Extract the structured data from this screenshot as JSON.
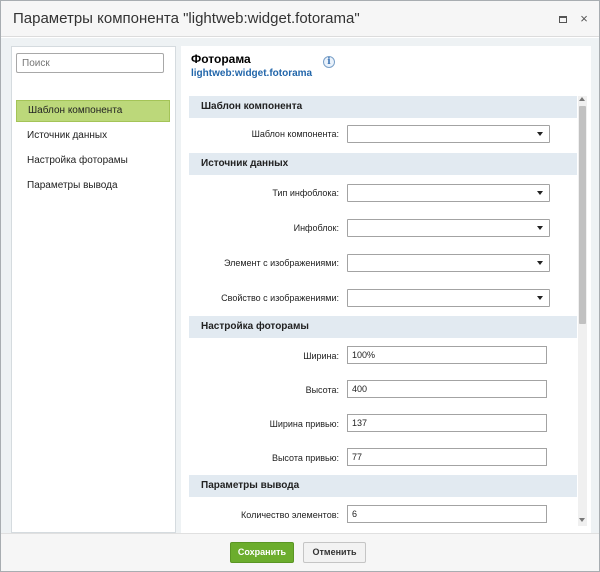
{
  "window": {
    "title": "Параметры компонента \"lightweb:widget.fotorama\"",
    "maximize_icon": "maximize-icon",
    "close_icon": "close-icon",
    "close_glyph": "×"
  },
  "sidebar": {
    "search_placeholder": "Поиск",
    "items": [
      {
        "label": "Шаблон компонента",
        "active": true
      },
      {
        "label": "Источник данных",
        "active": false
      },
      {
        "label": "Настройка фоторамы",
        "active": false
      },
      {
        "label": "Параметры вывода",
        "active": false
      }
    ]
  },
  "component": {
    "name": "Фоторама",
    "code": "lightweb:widget.fotorama",
    "info_glyph": "i"
  },
  "sections": {
    "template": {
      "title": "Шаблон компонента",
      "fields": [
        {
          "label": "Шаблон компонента:",
          "value": ""
        }
      ]
    },
    "source": {
      "title": "Источник данных",
      "fields": [
        {
          "label": "Тип инфоблока:",
          "value": ""
        },
        {
          "label": "Инфоблок:",
          "value": ""
        },
        {
          "label": "Элемент с изображениями:",
          "value": ""
        },
        {
          "label": "Свойство с изображениями:",
          "value": ""
        }
      ]
    },
    "fotorama": {
      "title": "Настройка фоторамы",
      "fields": [
        {
          "label": "Ширина:",
          "value": "100%"
        },
        {
          "label": "Высота:",
          "value": "400"
        },
        {
          "label": "Ширина привью:",
          "value": "137"
        },
        {
          "label": "Высота привью:",
          "value": "77"
        }
      ]
    },
    "output": {
      "title": "Параметры вывода",
      "fields": [
        {
          "label": "Количество элементов:",
          "value": "6"
        }
      ]
    }
  },
  "footer": {
    "save_label": "Сохранить",
    "cancel_label": "Отменить"
  },
  "colors": {
    "accent": "#6cad2d",
    "active_item": "#bcd87a",
    "section_header": "#e2eaf1",
    "link": "#2266aa"
  }
}
